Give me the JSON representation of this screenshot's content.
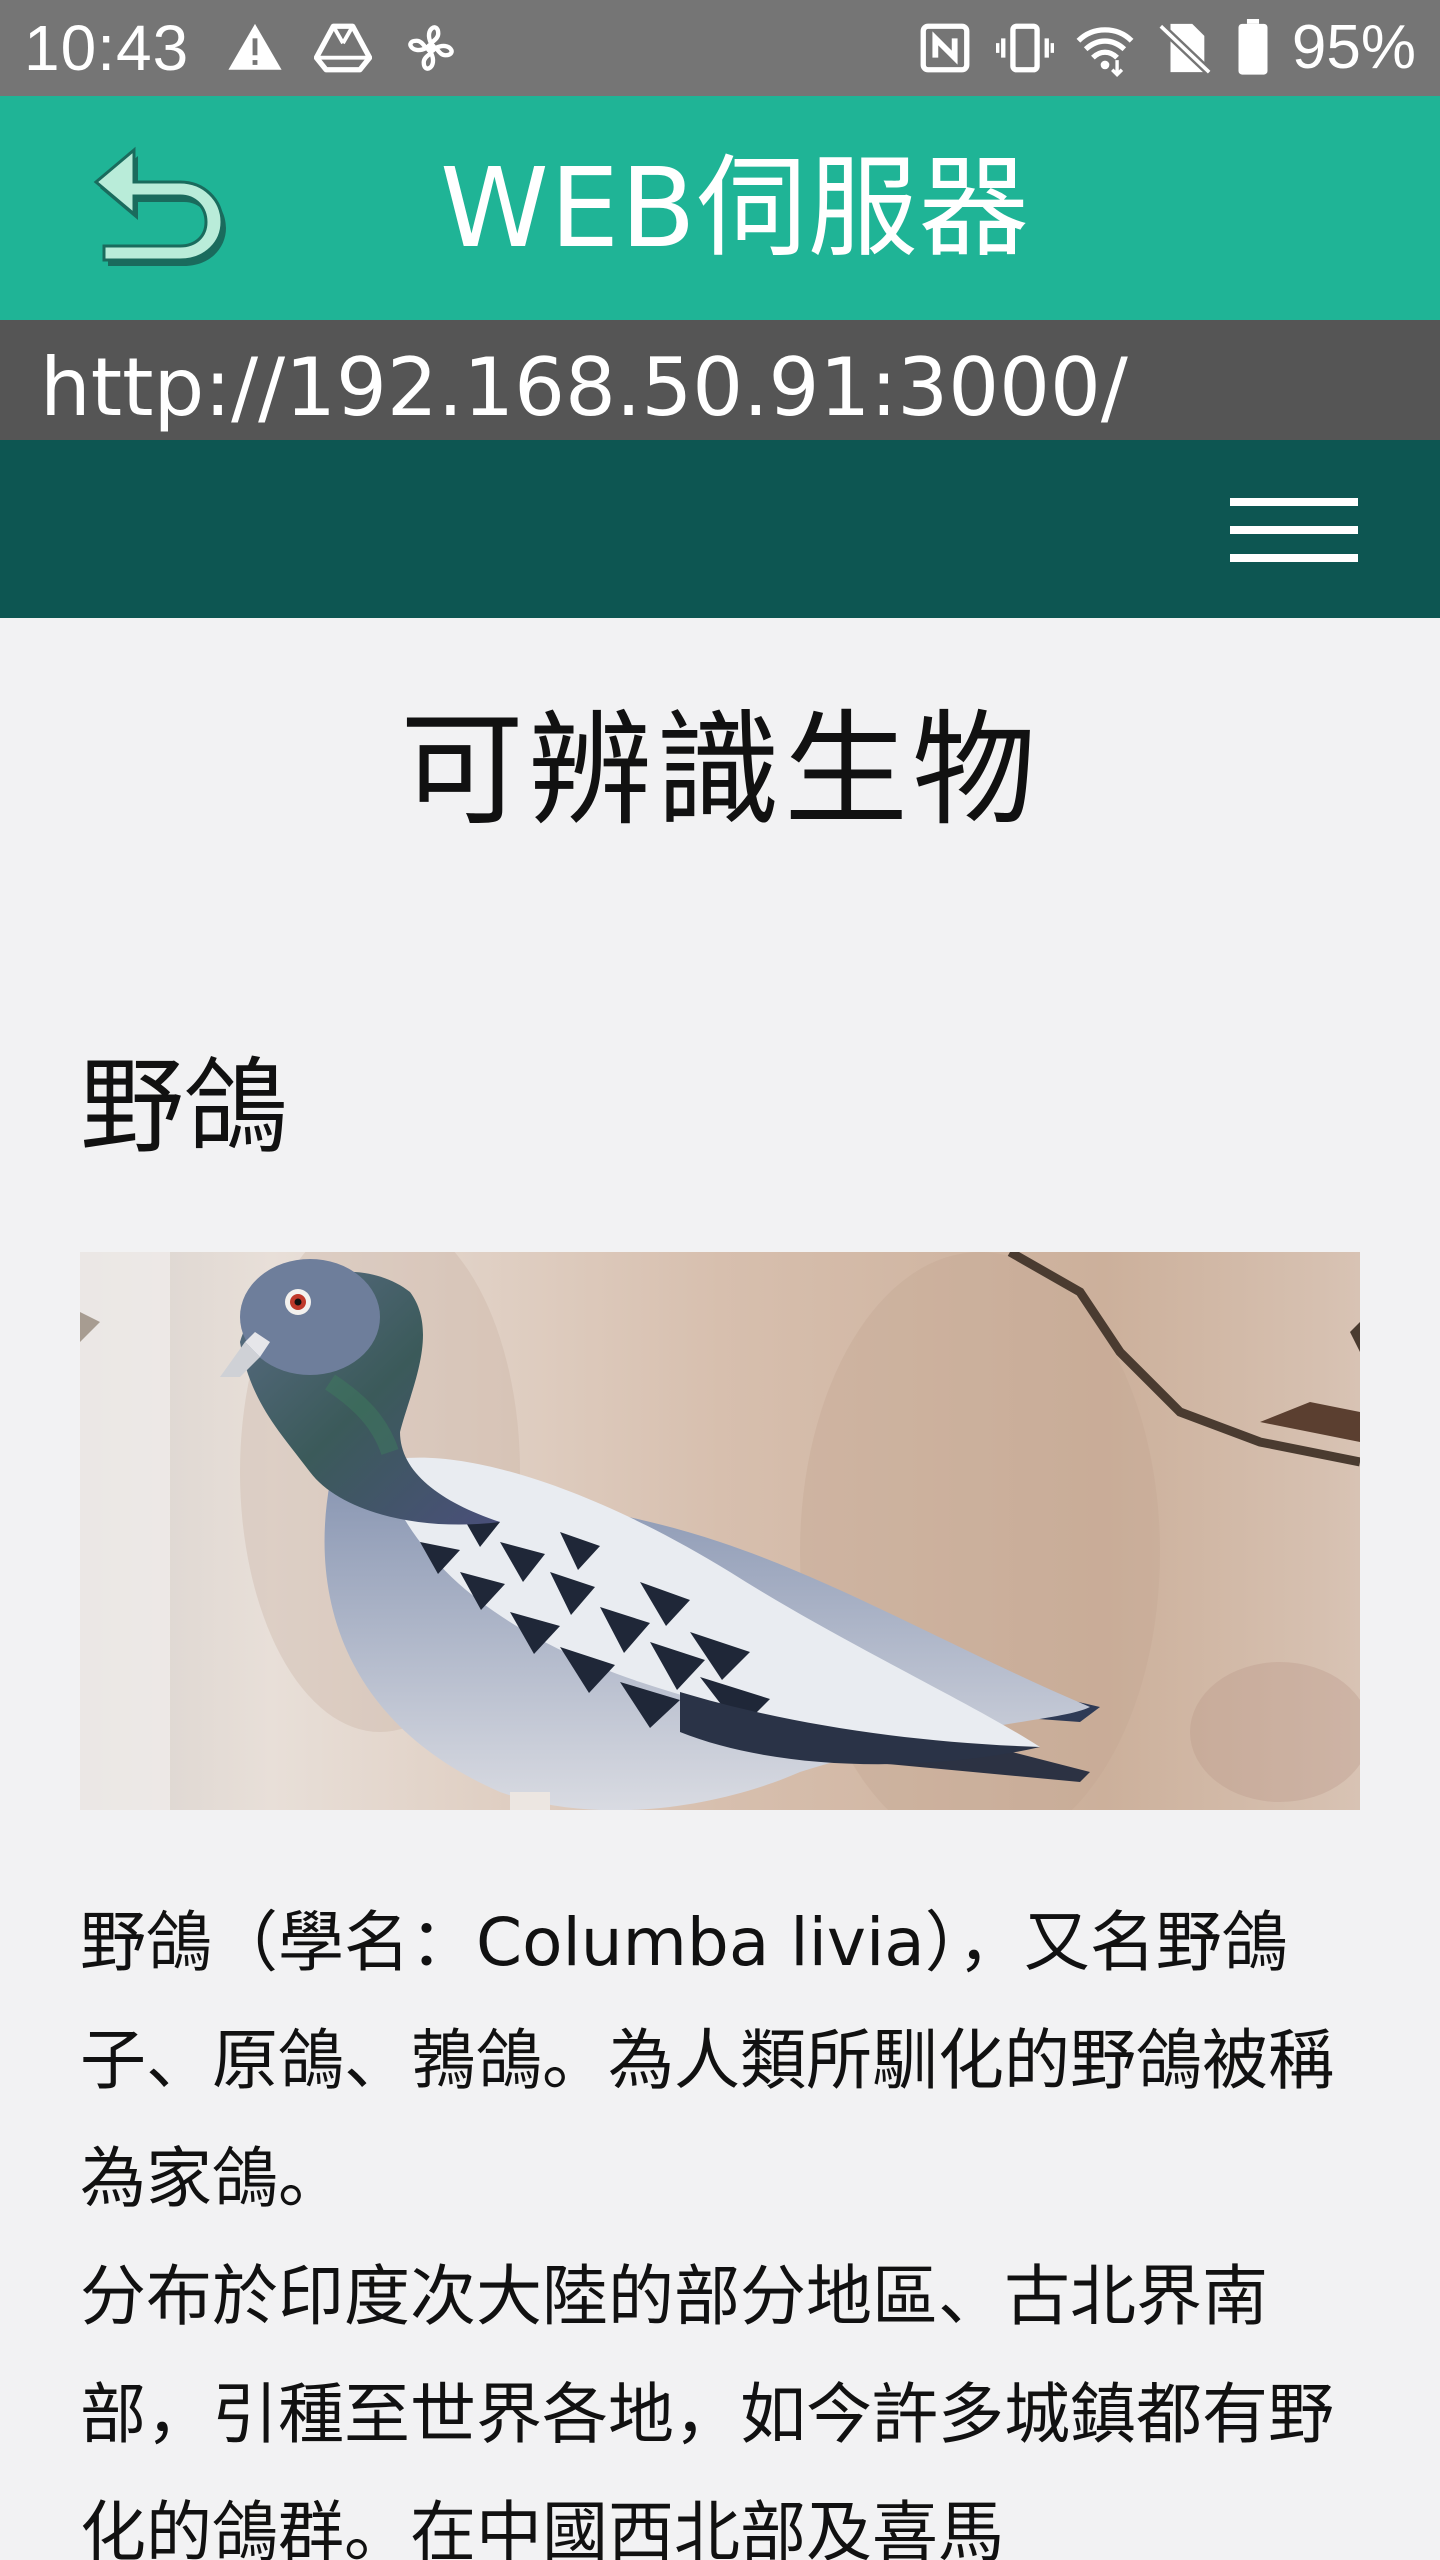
{
  "status_bar": {
    "time": "10:43",
    "battery": "95%",
    "left_icons": [
      "warning-icon",
      "drive-icon",
      "fan-icon"
    ],
    "right_icons": [
      "nfc-icon",
      "vibrate-icon",
      "wifi-icon",
      "no-sim-icon",
      "battery-icon"
    ]
  },
  "header": {
    "title": "WEB伺服器",
    "back_icon": "back-arrow-icon",
    "color": "#1fb496"
  },
  "url_bar": {
    "url": "http://192.168.50.91:3000/"
  },
  "nav": {
    "menu_icon": "hamburger-menu-icon",
    "color": "#0d5652"
  },
  "page": {
    "title": "可辨識生物",
    "section": {
      "heading": "野鴿",
      "image": "pigeon-photo",
      "paragraphs": [
        "野鴿（學名：Columba livia），又名野鴿子、原鴿、鵓鴿。為人類所馴化的野鴿被稱為家鴿。",
        "分布於印度次大陸的部分地區、古北界南部，引種至世界各地，如今許多城鎮都有野化的鴿群。在中國西北部及喜馬"
      ]
    }
  }
}
